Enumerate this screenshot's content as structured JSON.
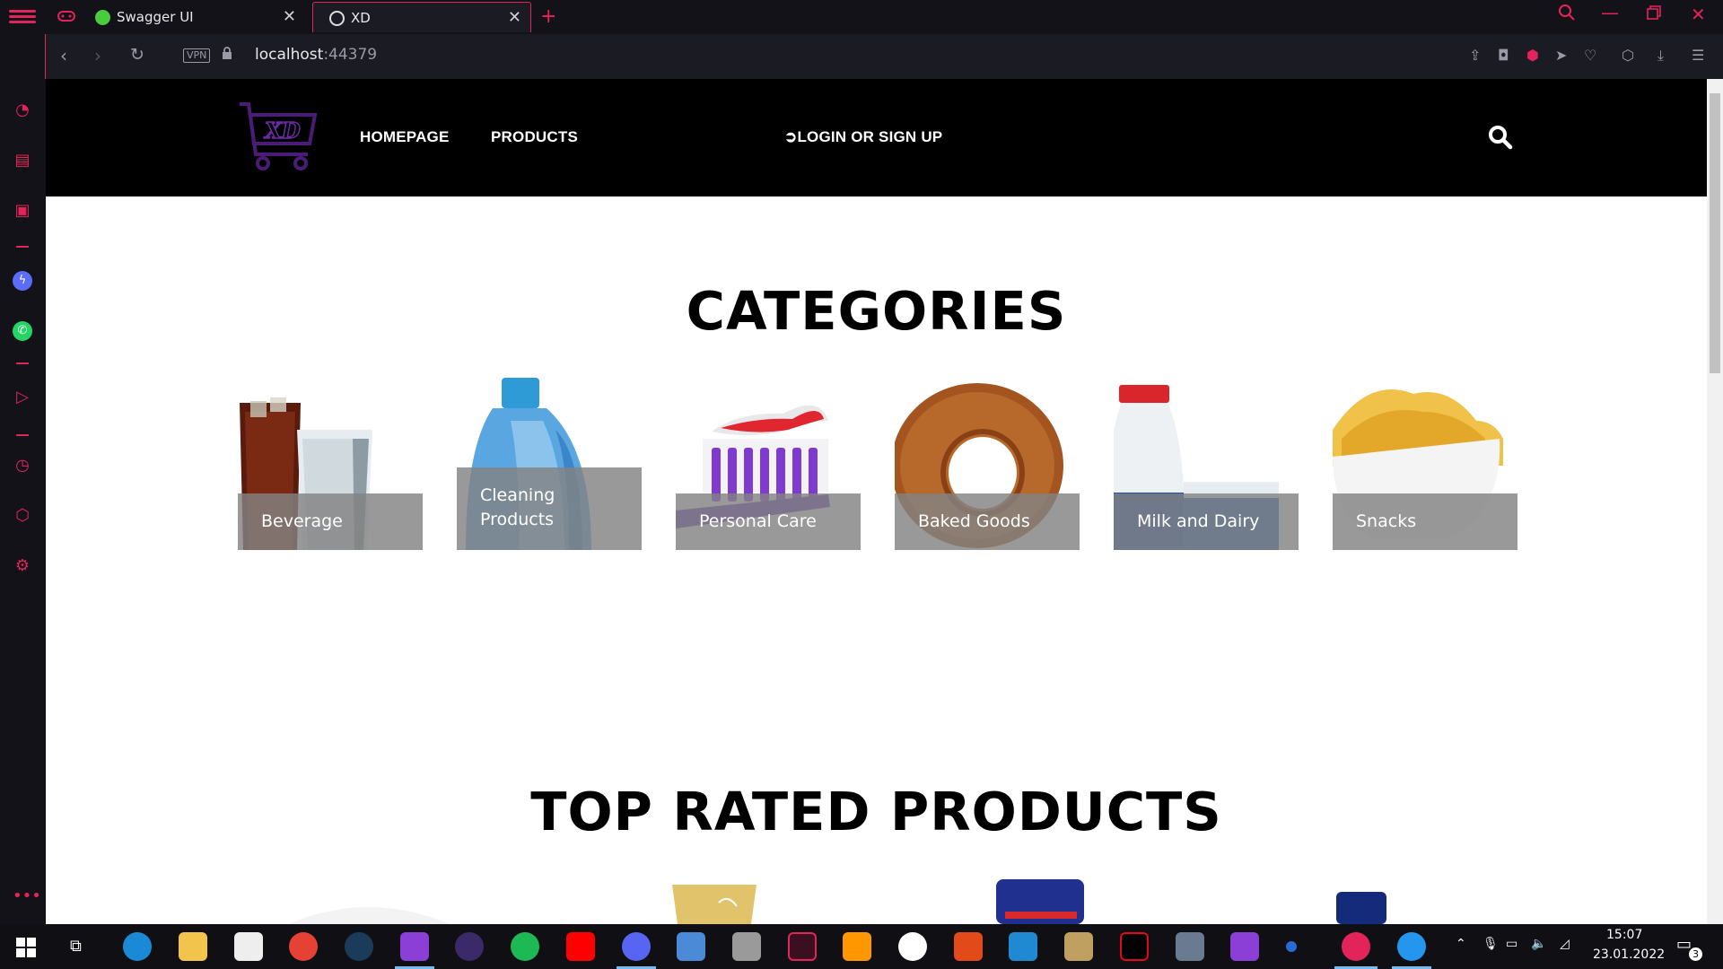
{
  "browser": {
    "tabs": [
      {
        "title": "Swagger UI"
      },
      {
        "title": "XD"
      }
    ],
    "url_host": "localhost",
    "url_port": ":44379",
    "vpn_label": "VPN",
    "accent_color": "#e3245a"
  },
  "site": {
    "logo_text": "XD",
    "nav": {
      "homepage": "HOMEPAGE",
      "products": "PRODUCTS",
      "login": "LOGIN OR SIGN UP"
    },
    "categories_title": "CATEGORIES",
    "categories": [
      {
        "label_lines": [
          "Beverage"
        ],
        "image": "soda-glass"
      },
      {
        "label_lines": [
          "Cleaning",
          "Products"
        ],
        "image": "detergent-bottle"
      },
      {
        "label_lines": [
          "Personal Care"
        ],
        "image": "toothbrush"
      },
      {
        "label_lines": [
          "Baked Goods"
        ],
        "image": "simit-bread"
      },
      {
        "label_lines": [
          "Milk and Dairy"
        ],
        "image": "milk-bottle"
      },
      {
        "label_lines": [
          "Snacks"
        ],
        "image": "chips-bowl"
      }
    ],
    "top_rated_title": "TOP RATED PRODUCTS"
  },
  "taskbar": {
    "time": "15:07",
    "date": "23.01.2022",
    "notification_count": "3"
  }
}
